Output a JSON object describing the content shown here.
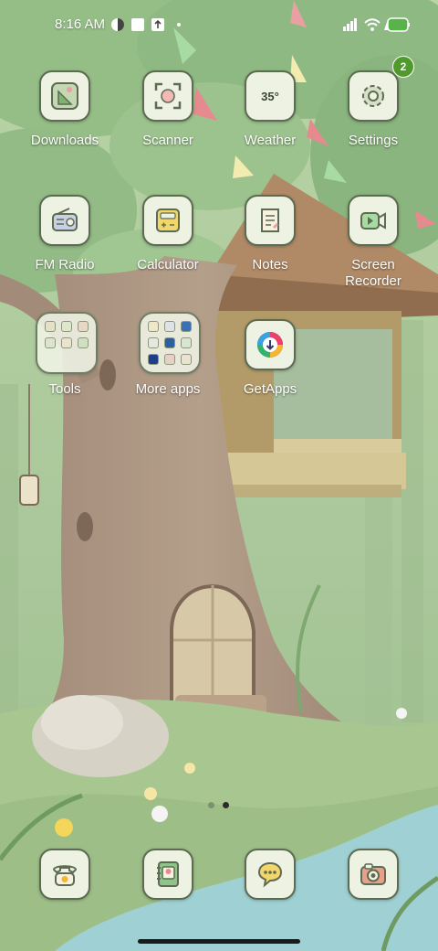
{
  "status_bar": {
    "time": "8:16 AM",
    "battery_level": "100"
  },
  "apps": {
    "downloads": "Downloads",
    "scanner": "Scanner",
    "weather": "Weather",
    "weather_temp": "35°",
    "settings": "Settings",
    "settings_badge": "2",
    "fm_radio": "FM Radio",
    "calculator": "Calculator",
    "notes": "Notes",
    "screen_recorder": "Screen\nRecorder",
    "tools": "Tools",
    "more_apps": "More apps",
    "getapps": "GetApps"
  },
  "page_indicator": {
    "pages": 2,
    "current": 2
  },
  "dock": [
    "phone-icon",
    "contacts-icon",
    "messaging-icon",
    "camera-icon"
  ],
  "colors": {
    "tile_bg": "#eef2e3",
    "tile_border": "#5c6b52",
    "badge": "#4f9a2a",
    "label": "#ffffff"
  }
}
